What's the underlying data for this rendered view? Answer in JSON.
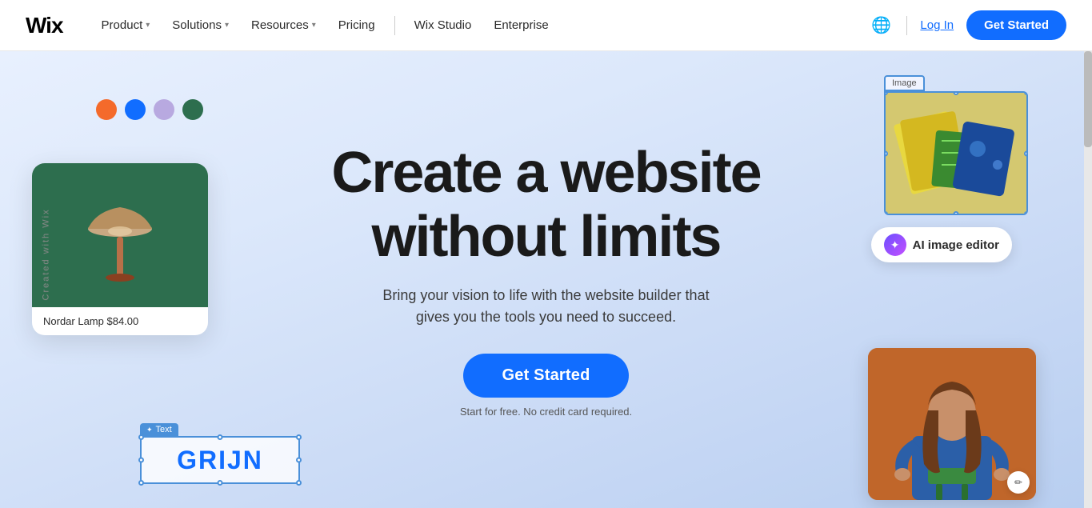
{
  "nav": {
    "logo": "Wix",
    "items": [
      {
        "label": "Product",
        "hasDropdown": true
      },
      {
        "label": "Solutions",
        "hasDropdown": true
      },
      {
        "label": "Resources",
        "hasDropdown": true
      },
      {
        "label": "Pricing",
        "hasDropdown": false
      },
      {
        "label": "Wix Studio",
        "hasDropdown": false
      },
      {
        "label": "Enterprise",
        "hasDropdown": false
      }
    ],
    "login_label": "Log In",
    "get_started_label": "Get Started"
  },
  "hero": {
    "title_line1": "Create a website",
    "title_line2": "without limits",
    "subtitle_line1": "Bring your vision to life with the website builder that",
    "subtitle_line2": "gives you the tools you need to succeed.",
    "cta_button": "Get Started",
    "free_note": "Start for free. No credit card required.",
    "lamp_caption": "Nordar Lamp $84.00",
    "image_widget_label": "Image",
    "text_widget_label": "Text",
    "ai_badge_text": "AI image editor",
    "grijn_text": "GRIJN"
  },
  "side_label": "Created with Wix",
  "colors": {
    "accent_blue": "#116dff",
    "nav_bg": "#ffffff",
    "hero_bg_start": "#e8f0fe",
    "hero_bg_end": "#b8cef0",
    "dot_orange": "#f46a2b",
    "dot_blue": "#116dff",
    "dot_purple": "#b8a9e0",
    "dot_green": "#2d6e4e"
  }
}
